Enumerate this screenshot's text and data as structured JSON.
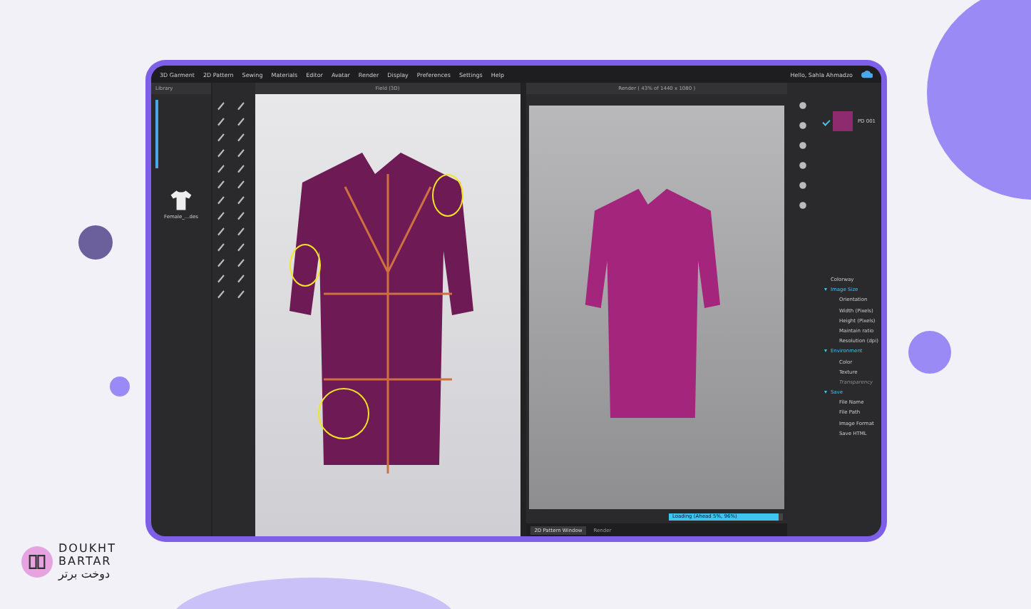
{
  "menu": {
    "items": [
      "3D Garment",
      "2D Pattern",
      "Sewing",
      "Materials",
      "Editor",
      "Avatar",
      "Render",
      "Display",
      "Preferences",
      "Settings",
      "Help"
    ]
  },
  "user": {
    "greeting": "Hello, Sahla Ahmadzo"
  },
  "library": {
    "title": "Library",
    "item_label": "Female_...des"
  },
  "viewport_3d": {
    "title": "Field (3D)"
  },
  "render_window": {
    "title": "Render ( 43% of 1440 x 1080 )",
    "progress": {
      "label": "Loading (Ahead 5%, 96%)",
      "level": 0.96
    }
  },
  "colorway_list": [
    {
      "name": "PD 001",
      "checked": true,
      "color": "#8e2a6e"
    }
  ],
  "properties": [
    {
      "label": "Colorway",
      "disabled": false
    },
    {
      "label": "Image Size",
      "disabled": false,
      "expanded": true,
      "children": [
        {
          "label": "Orientation",
          "disabled": false
        },
        {
          "label": "Width (Pixels)",
          "disabled": false
        },
        {
          "label": "Height (Pixels)",
          "disabled": false
        },
        {
          "label": "Maintain ratio",
          "disabled": false
        },
        {
          "label": "Resolution (dpi)",
          "disabled": false
        }
      ]
    },
    {
      "label": "Environment",
      "disabled": false,
      "expanded": true,
      "children": [
        {
          "label": "Color",
          "disabled": false
        },
        {
          "label": "Texture",
          "disabled": false
        },
        {
          "label": "Transparency",
          "disabled": true
        }
      ]
    },
    {
      "label": "Save",
      "disabled": false,
      "expanded": true,
      "children": [
        {
          "label": "File Name",
          "disabled": false
        },
        {
          "label": "File Path",
          "disabled": false
        },
        {
          "label": "Image Format",
          "disabled": false
        },
        {
          "label": "Save HTML",
          "disabled": false
        }
      ]
    }
  ],
  "bottom_tabs": [
    {
      "label": "2D Pattern Window",
      "selected": true
    },
    {
      "label": "Render",
      "selected": false
    }
  ],
  "logo": {
    "line_1": "DOUKHT",
    "line_2": "BARTAR",
    "persian": "دوخت برتر"
  }
}
